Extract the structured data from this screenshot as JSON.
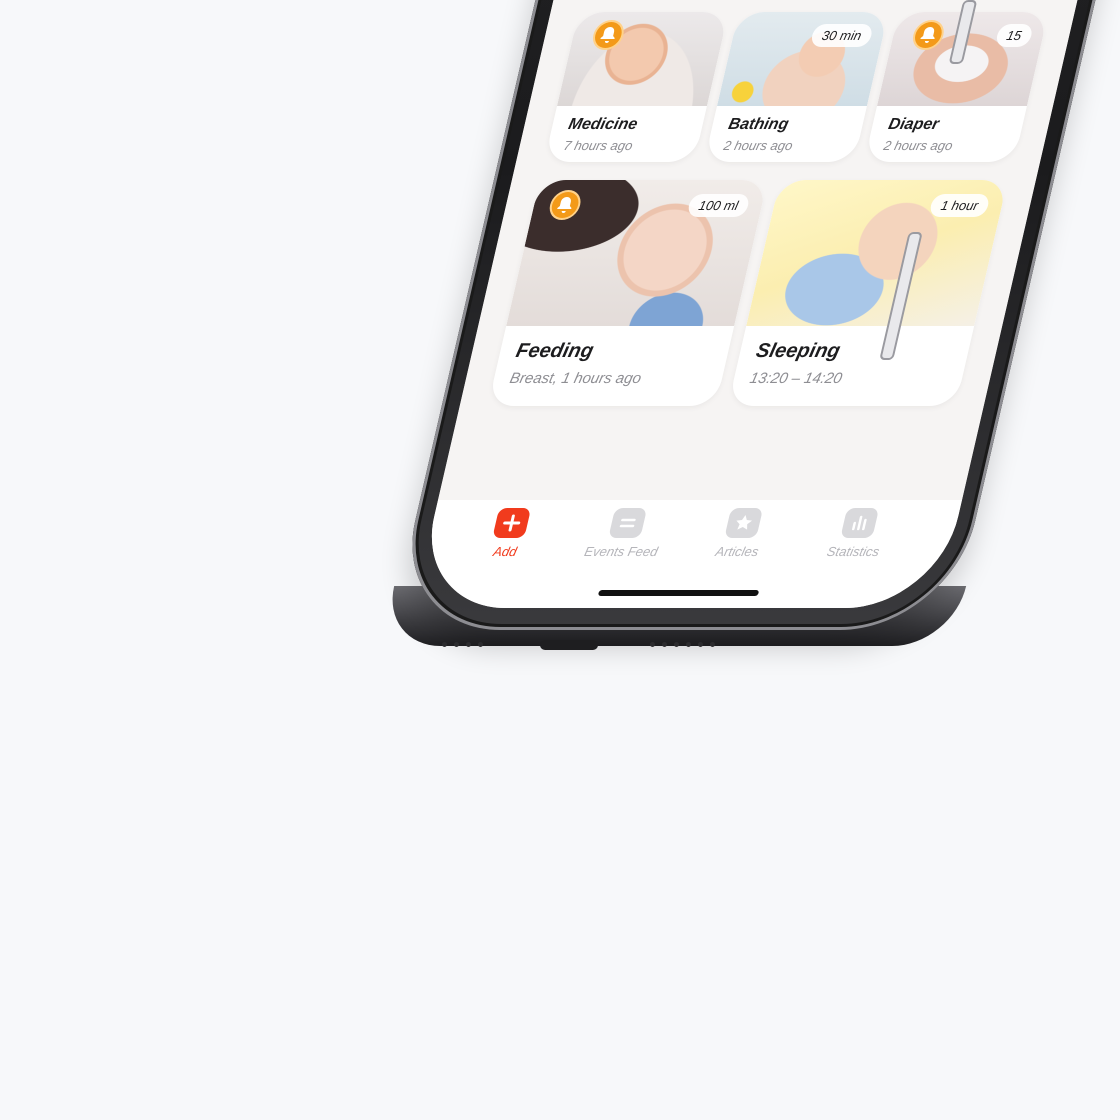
{
  "cards": {
    "medicine": {
      "title": "Medicine",
      "subtitle": "7 hours ago",
      "has_bell": true
    },
    "bathing": {
      "title": "Bathing",
      "subtitle": "2 hours ago",
      "badge": "30 min"
    },
    "diaper": {
      "title": "Diaper",
      "subtitle": "2 hours ago",
      "badge": "15",
      "has_bell": true
    },
    "feeding": {
      "title": "Feeding",
      "subtitle": "Breast, 1 hours ago",
      "badge": "100 ml",
      "has_bell": true
    },
    "sleeping": {
      "title": "Sleeping",
      "subtitle": "13:20 – 14:20",
      "badge": "1 hour"
    }
  },
  "tabbar": {
    "tabs": [
      {
        "label": "Add",
        "icon": "plus-icon",
        "active": true
      },
      {
        "label": "Events Feed",
        "icon": "feed-icon",
        "active": false
      },
      {
        "label": "Articles",
        "icon": "star-icon",
        "active": false
      },
      {
        "label": "Statistics",
        "icon": "bar-chart-icon",
        "active": false
      }
    ]
  },
  "colors": {
    "accent": "#f13b1d",
    "bell": "#f39a19",
    "inactive": "#b5b5ba",
    "background": "#f7f8fa"
  }
}
